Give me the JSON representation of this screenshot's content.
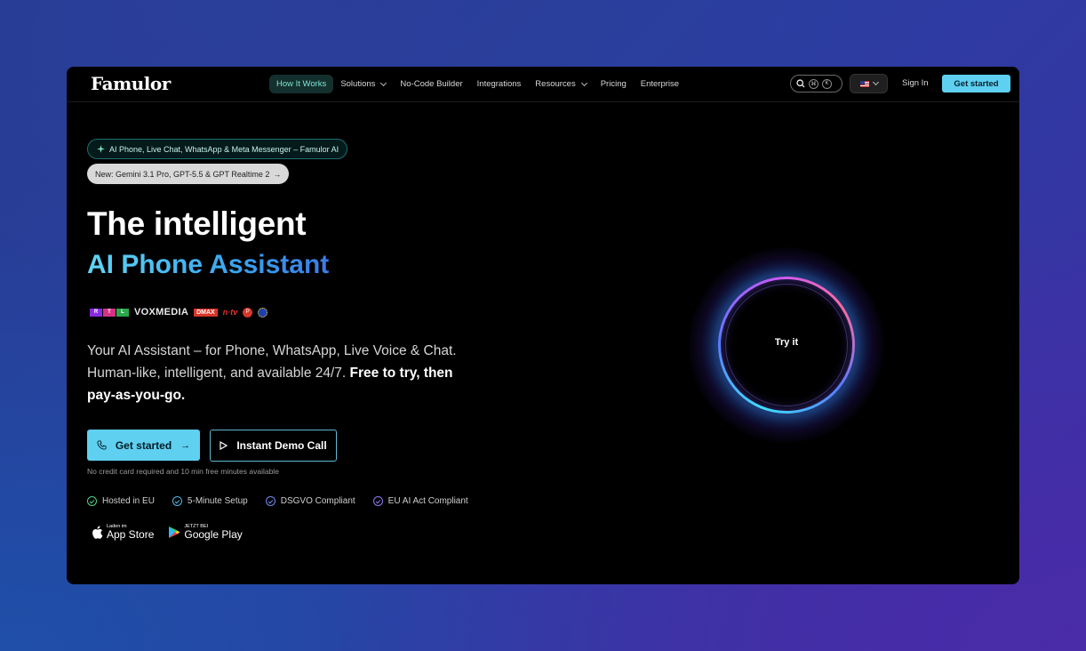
{
  "brand": {
    "name": "Famulor"
  },
  "nav": {
    "items": [
      {
        "label": "How It Works",
        "active": true,
        "dropdown": false
      },
      {
        "label": "Solutions",
        "active": false,
        "dropdown": true
      },
      {
        "label": "No-Code Builder",
        "active": false,
        "dropdown": false
      },
      {
        "label": "Integrations",
        "active": false,
        "dropdown": false
      },
      {
        "label": "Resources",
        "active": false,
        "dropdown": true
      },
      {
        "label": "Pricing",
        "active": false,
        "dropdown": false
      },
      {
        "label": "Enterprise",
        "active": false,
        "dropdown": false
      }
    ],
    "search_keys": [
      "⌘",
      "K"
    ],
    "sign_in": "Sign In",
    "cta": "Get started"
  },
  "hero": {
    "badge_primary": "AI Phone, Live Chat, WhatsApp & Meta Messenger – Famulor AI",
    "badge_secondary": "New: Gemini 3.1 Pro, GPT-5.5 & GPT Realtime 2",
    "title_line1": "The intelligent",
    "title_line2": "AI Phone Assistant",
    "description_plain": "Your AI Assistant – for Phone, WhatsApp, Live Voice & Chat. Human-like, intelligent, and available 24/7. ",
    "description_bold": "Free to try, then pay-as-you-go.",
    "primary_button": "Get started",
    "secondary_button": "Instant Demo Call",
    "note": "No credit card required and 10 min free minutes available",
    "features": [
      {
        "label": "Hosted in EU",
        "color": "#4fd18b"
      },
      {
        "label": "5-Minute Setup",
        "color": "#4fb8e8"
      },
      {
        "label": "DSGVO Compliant",
        "color": "#6f8cf0"
      },
      {
        "label": "EU AI Act Compliant",
        "color": "#8c7cf0"
      }
    ],
    "stores": {
      "apple_small": "Laden im",
      "apple_big": "App Store",
      "google_small": "JETZT BEI",
      "google_big": "Google Play"
    }
  },
  "press_logos": {
    "rtl": [
      "R",
      "T",
      "L"
    ],
    "vox": "VOXMEDIA",
    "dmax": "DMAX",
    "ntv": "n·tv",
    "p": "P"
  },
  "orb": {
    "label": "Try it"
  },
  "colors": {
    "accent": "#5fd0f0",
    "background": "#000000"
  }
}
